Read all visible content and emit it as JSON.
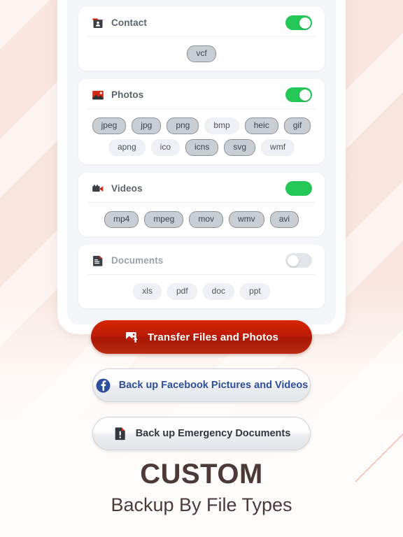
{
  "background": {
    "base_color": "#fdf3ef",
    "stripe_color": "#eec8ba",
    "accent_line_color": "#f0baac"
  },
  "phone": {
    "frame_color": "#ffffff",
    "screen_color": "#f4f5f9"
  },
  "categories": [
    {
      "id": "contact",
      "label": "Contact",
      "icon": "contact-card-icon",
      "enabled": true,
      "toggle_state": "on",
      "toggle_knob_visible": true,
      "chips": [
        {
          "label": "vcf",
          "selected": true
        }
      ]
    },
    {
      "id": "photos",
      "label": "Photos",
      "icon": "photo-image-icon",
      "enabled": true,
      "toggle_state": "on",
      "toggle_knob_visible": true,
      "chips": [
        {
          "label": "jpeg",
          "selected": true
        },
        {
          "label": "jpg",
          "selected": true
        },
        {
          "label": "png",
          "selected": true
        },
        {
          "label": "bmp",
          "selected": false
        },
        {
          "label": "heic",
          "selected": true
        },
        {
          "label": "gif",
          "selected": true
        },
        {
          "label": "apng",
          "selected": false
        },
        {
          "label": "ico",
          "selected": false
        },
        {
          "label": "icns",
          "selected": true
        },
        {
          "label": "svg",
          "selected": true
        },
        {
          "label": "wmf",
          "selected": false
        }
      ]
    },
    {
      "id": "videos",
      "label": "Videos",
      "icon": "video-camera-icon",
      "enabled": true,
      "toggle_state": "on",
      "toggle_knob_visible": false,
      "chips": [
        {
          "label": "mp4",
          "selected": true
        },
        {
          "label": "mpeg",
          "selected": true
        },
        {
          "label": "mov",
          "selected": true
        },
        {
          "label": "wmv",
          "selected": true
        },
        {
          "label": "avi",
          "selected": true
        }
      ]
    },
    {
      "id": "documents",
      "label": "Documents",
      "icon": "document-lines-icon",
      "enabled": false,
      "toggle_state": "off",
      "toggle_knob_visible": true,
      "chips": [
        {
          "label": "xls",
          "selected": false
        },
        {
          "label": "pdf",
          "selected": false
        },
        {
          "label": "doc",
          "selected": false
        },
        {
          "label": "ppt",
          "selected": false
        }
      ]
    }
  ],
  "actions": [
    {
      "id": "transfer",
      "label": "Transfer Files and Photos",
      "icon": "image-upload-icon",
      "style": "primary-red",
      "color": "#bb1b07"
    },
    {
      "id": "facebook",
      "label": "Back up Facebook Pictures and Videos",
      "icon": "facebook-icon",
      "style": "secondary-light",
      "color": "#2d4f9b"
    },
    {
      "id": "emergency",
      "label": "Back up Emergency Documents",
      "icon": "emergency-document-icon",
      "style": "secondary-light",
      "color": "#33373d"
    }
  ],
  "headline": {
    "title": "CUSTOM",
    "subtitle": "Backup By File Types",
    "color": "#4b3a38"
  }
}
